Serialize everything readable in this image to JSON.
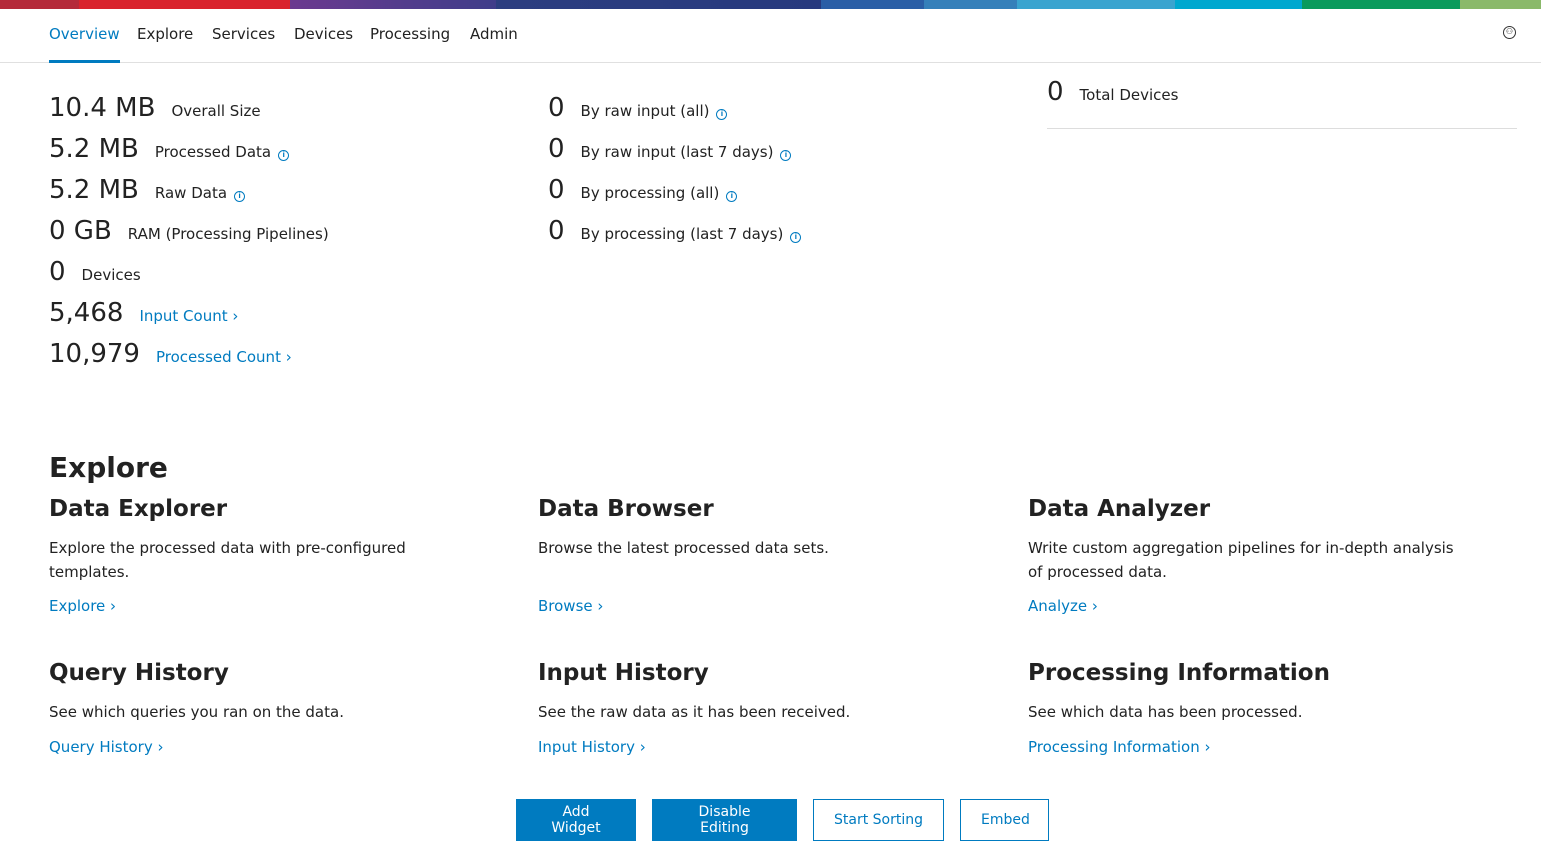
{
  "nav": {
    "items": [
      "Overview",
      "Explore",
      "Services",
      "Devices",
      "Processing",
      "Admin"
    ],
    "active": "Overview",
    "user_icon": "user-circle-icon"
  },
  "storage": [
    {
      "value": "10.4 MB",
      "label": "Overall Size",
      "info": false
    },
    {
      "value": "5.2 MB",
      "label": "Processed Data",
      "info": true
    },
    {
      "value": "5.2 MB",
      "label": "Raw Data",
      "info": true
    },
    {
      "value": "0 GB",
      "label": "RAM (Processing Pipelines)",
      "info": false
    },
    {
      "value": "0",
      "label": "Devices",
      "info": false
    }
  ],
  "counts": [
    {
      "value": "5,468",
      "label": "Input Count ›"
    },
    {
      "value": "10,979",
      "label": "Processed Count ›"
    }
  ],
  "inputs": [
    {
      "value": "0",
      "label": "By raw input (all)"
    },
    {
      "value": "0",
      "label": "By raw input (last 7 days)"
    },
    {
      "value": "0",
      "label": "By processing (all)"
    },
    {
      "value": "0",
      "label": "By processing (last 7 days)"
    }
  ],
  "devices": {
    "value": "0",
    "label": "Total Devices"
  },
  "explore": {
    "title": "Explore",
    "cards": [
      {
        "title": "Data Explorer",
        "text": "Explore the processed data with pre-configured templates.",
        "link": "Explore ›"
      },
      {
        "title": "Data Browser",
        "text": "Browse the latest processed data sets.",
        "link": "Browse ›"
      },
      {
        "title": "Data Analyzer",
        "text": "Write custom aggregation pipelines for in-depth analysis of processed data.",
        "link": "Analyze ›"
      },
      {
        "title": "Query History",
        "text": "See which queries you ran on the data.",
        "link": "Query History ›"
      },
      {
        "title": "Input History",
        "text": "See the raw data as it has been received.",
        "link": "Input History ›"
      },
      {
        "title": "Processing Information",
        "text": "See which data has been processed.",
        "link": "Processing Information ›"
      }
    ]
  },
  "buttons": {
    "add_widget": "Add Widget",
    "disable_editing": "Disable Editing",
    "start_sorting": "Start Sorting",
    "embed": "Embed"
  },
  "colors": {
    "accent": "#007bc0"
  }
}
